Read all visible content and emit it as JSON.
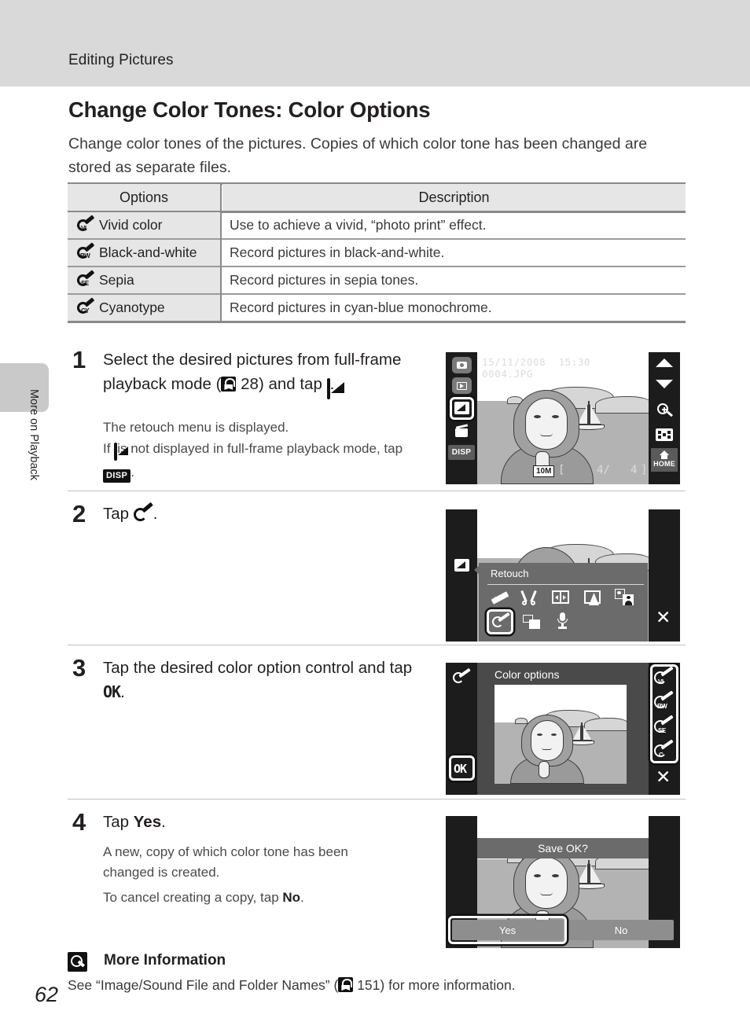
{
  "header": {
    "section_title": "Editing Pictures"
  },
  "sidebar": {
    "thumb_label": "More on Playback"
  },
  "page": {
    "number": "62"
  },
  "main": {
    "heading": "Change Color Tones: Color Options",
    "intro": "Change color tones of the pictures. Copies of which color tone has been changed are stored as separate files."
  },
  "table": {
    "headers": [
      "Options",
      "Description"
    ],
    "rows": [
      {
        "icon": "vivid-color-icon",
        "tag": "VI",
        "option": "Vivid color",
        "description": "Use to achieve a vivid, “photo print” effect."
      },
      {
        "icon": "black-and-white-icon",
        "tag": "BW",
        "option": "Black-and-white",
        "description": "Record pictures in black-and-white."
      },
      {
        "icon": "sepia-icon",
        "tag": "SE",
        "option": "Sepia",
        "description": "Record pictures in sepia tones."
      },
      {
        "icon": "cyanotype-icon",
        "tag": "CY",
        "option": "Cyanotype",
        "description": "Record pictures in cyan-blue monochrome."
      }
    ]
  },
  "steps": [
    {
      "number": "1",
      "text_a": "Select the desired pictures from full-frame playback mode (",
      "ref_page": "28",
      "text_b": ") and tap",
      "text_c": ".",
      "sub1": "The retouch menu is displayed.",
      "sub2_a": "If",
      "sub2_b": "is not displayed in full-frame playback mode, tap",
      "sub2_c": "."
    },
    {
      "number": "2",
      "text_a": "Tap",
      "text_c": "."
    },
    {
      "number": "3",
      "text_a": "Tap the desired color option control and tap",
      "ok_label": "OK",
      "text_c": "."
    },
    {
      "number": "4",
      "text_a": "Tap",
      "yes_label": "Yes",
      "text_c": ".",
      "sub1": "A new, copy of which color tone has been changed is created.",
      "sub2_a": "To cancel creating a copy, tap",
      "sub2_no": "No",
      "sub2_c": "."
    }
  ],
  "screens": {
    "playback": {
      "date": "15/11/2008",
      "time": "15:30",
      "filename": "0004.JPG",
      "image_size": "10M",
      "frame_counter_open": "[",
      "frame_current": "4/",
      "frame_total": "4",
      "frame_counter_close": "]",
      "left_controls": [
        "camera-icon",
        "playback-icon",
        "retouch-icon",
        "delete-icon",
        "disp-button"
      ],
      "disp_label": "DISP",
      "right_controls": [
        "chevron-up-icon",
        "chevron-down-icon",
        "zoom-in-icon",
        "thumbnail-grid-icon",
        "home-button"
      ],
      "home_label": "HOME"
    },
    "retouch_menu": {
      "title": "Retouch",
      "items": [
        "quick-retouch-icon",
        "crop-icon",
        "d-lighting-icon",
        "contrast-icon",
        "face-touchup-icon",
        "color-options-icon",
        "small-picture-icon",
        "voice-memo-icon"
      ],
      "close_label": "✕"
    },
    "color_options": {
      "title": "Color options",
      "options": [
        {
          "icon": "vivid-color-icon",
          "tag": "VI"
        },
        {
          "icon": "black-and-white-icon",
          "tag": "BW"
        },
        {
          "icon": "sepia-icon",
          "tag": "SE"
        },
        {
          "icon": "cyanotype-icon",
          "tag": "C"
        }
      ],
      "ok_label": "OK",
      "close_label": "✕"
    },
    "save_dialog": {
      "prompt": "Save OK?",
      "yes_label": "Yes",
      "no_label": "No"
    }
  },
  "more_information": {
    "title": "More Information",
    "text_a": "See “Image/Sound File and Folder Names” (",
    "ref_page": "151",
    "text_b": ") for more information."
  },
  "colors": {
    "header_bg": "#d9d9d9",
    "table_header_bg": "#e6e6e6",
    "screen_bg": "#1c1c1c",
    "menu_bg": "#6b6b6b"
  }
}
